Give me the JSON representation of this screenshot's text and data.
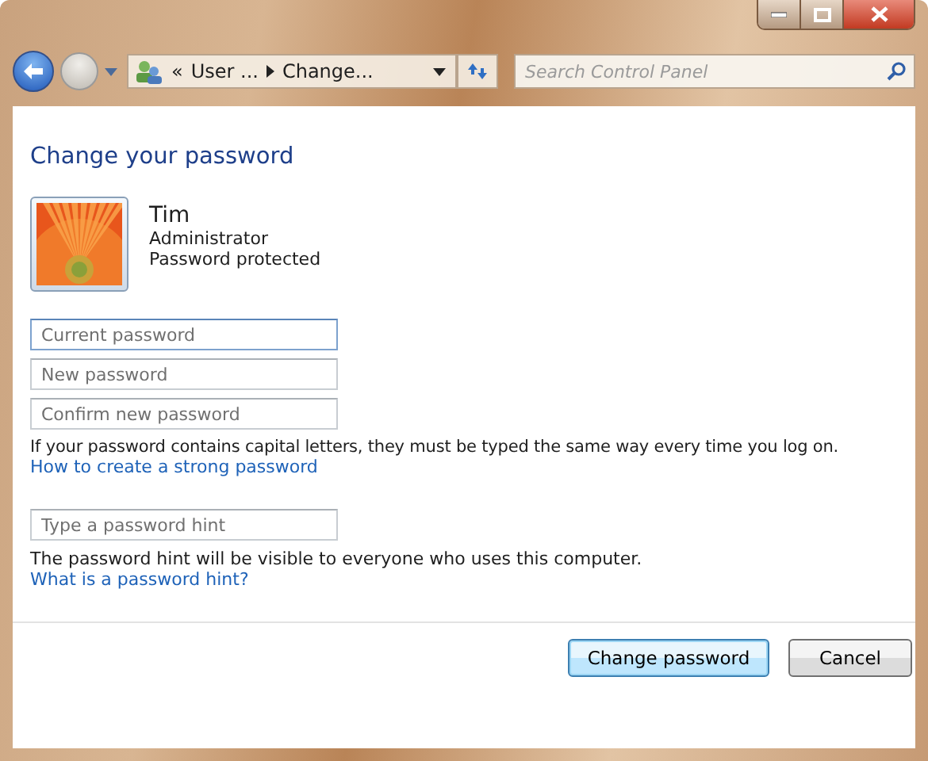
{
  "nav": {
    "breadcrumb": [
      "«",
      "User ...",
      "Change..."
    ],
    "search": {
      "placeholder": "Search Control Panel"
    }
  },
  "title": "Change your password",
  "account": {
    "name": "Tim",
    "role": "Administrator",
    "status": "Password protected"
  },
  "password_fields": [
    {
      "placeholder": "Current password",
      "focused": true
    },
    {
      "placeholder": "New password",
      "focused": false
    },
    {
      "placeholder": "Confirm new password",
      "focused": false
    }
  ],
  "capital_note": "If your password contains capital letters, they must be typed the same way every time you log on.",
  "strong_link": "How to create a strong password",
  "hint_field": {
    "placeholder": "Type a password hint"
  },
  "hint_note": "The password hint will be visible to everyone who uses this computer.",
  "hint_link": "What is a password hint?",
  "buttons": [
    {
      "label": "Change password",
      "default": true
    },
    {
      "label": "Cancel",
      "default": false
    }
  ]
}
